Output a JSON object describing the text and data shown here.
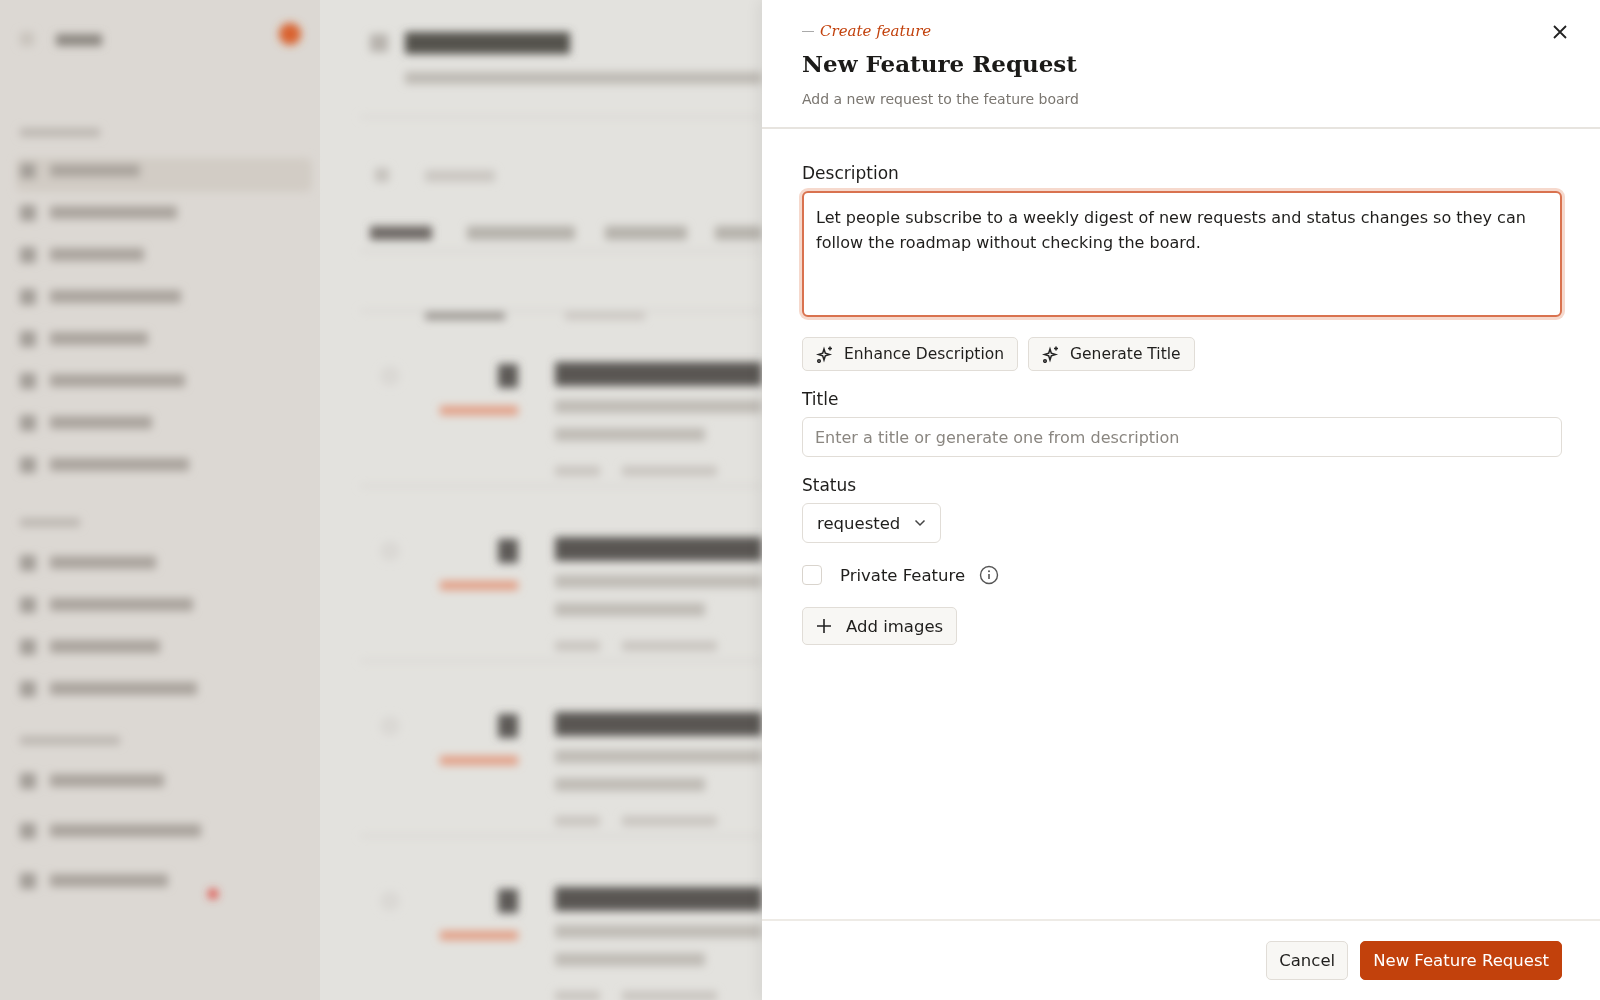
{
  "panel": {
    "eyebrow": "Create feature",
    "title": "New Feature Request",
    "subtitle": "Add a new request to the feature board"
  },
  "description": {
    "label": "Description",
    "value": "Let people subscribe to a weekly digest of new requests and status changes so they can follow the roadmap without checking the board.",
    "focused": true
  },
  "ai_buttons": [
    "Enhance Description",
    "Generate Title"
  ],
  "title_field": {
    "label": "Title",
    "placeholder": "Enter a title or generate one from description"
  },
  "status": {
    "label": "Status",
    "value": "requested"
  },
  "private": {
    "label": "Private Feature",
    "checked": false
  },
  "add_images": {
    "label": "Add images"
  },
  "footer": {
    "buttons": [
      {
        "label": "Cancel",
        "kind": "secondary"
      },
      {
        "label": "New Feature Request",
        "kind": "primary"
      }
    ]
  }
}
